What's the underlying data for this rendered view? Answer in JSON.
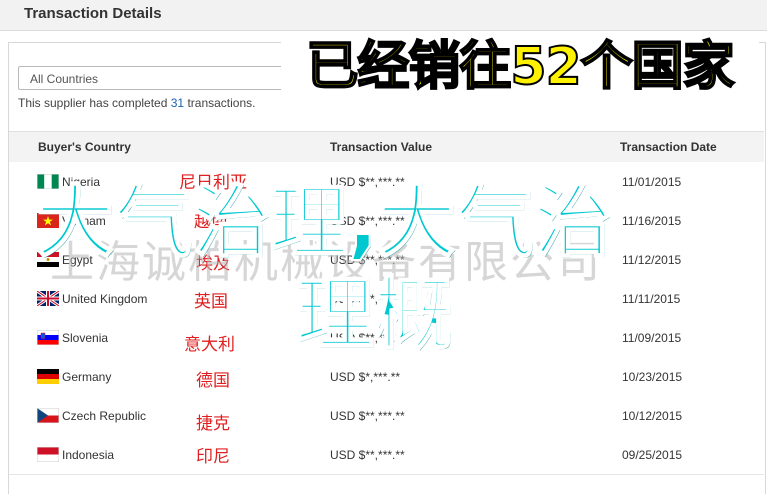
{
  "window": {
    "title": "Transaction Details"
  },
  "filter": {
    "country_select": "All Countries"
  },
  "summary": {
    "prefix": "This supplier has completed ",
    "count": "31",
    "suffix": " transactions."
  },
  "table": {
    "headers": {
      "country": "Buyer's Country",
      "value": "Transaction Value",
      "date": "Transaction Date"
    },
    "rows": [
      {
        "country": "Nigeria",
        "flag": "nigeria-flag",
        "value": "USD $**,***.**",
        "date": "11/01/2015",
        "cn": "尼日利亚"
      },
      {
        "country": "Vietnam",
        "flag": "vietnam-flag",
        "value": "USD $**,***.**",
        "date": "11/16/2015",
        "cn": "越南"
      },
      {
        "country": "Egypt",
        "flag": "egypt-flag",
        "value": "USD $**,***.**",
        "date": "11/12/2015",
        "cn": "埃及"
      },
      {
        "country": "United Kingdom",
        "flag": "uk-flag",
        "value": "USD $**,***.**",
        "date": "11/11/2015",
        "cn": "英国"
      },
      {
        "country": "Slovenia",
        "flag": "slovenia-flag",
        "value": "USD $**,***.**",
        "date": "11/09/2015",
        "cn": "意大利"
      },
      {
        "country": "Germany",
        "flag": "germany-flag",
        "value": "USD $*,***.**",
        "date": "10/23/2015",
        "cn": "德国"
      },
      {
        "country": "Czech Republic",
        "flag": "czech-flag",
        "value": "USD $**,***.**",
        "date": "10/12/2015",
        "cn": "捷克"
      },
      {
        "country": "Indonesia",
        "flag": "indonesia-flag",
        "value": "USD $**,***.**",
        "date": "09/25/2015",
        "cn": "印尼"
      }
    ]
  },
  "overlays": {
    "banner": "已经销往52个国家",
    "headline_line1": "大气治理,大气治",
    "headline_line2": "理概",
    "watermark": "上海诚柏机械设备有限公司"
  },
  "colors": {
    "accent_link": "#1a62b3",
    "annotation_red": "#e02020",
    "headline_cyan": "#00c8d0"
  }
}
